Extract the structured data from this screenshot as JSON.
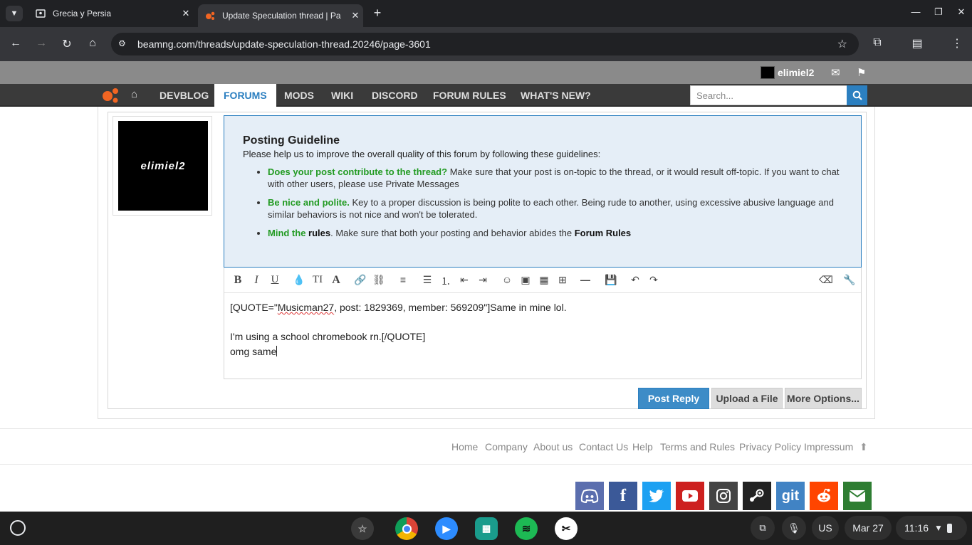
{
  "browser": {
    "tabs": [
      {
        "title": "Grecia y Persia",
        "active": false
      },
      {
        "title": "Update Speculation thread | Pa",
        "active": true
      }
    ],
    "url": "beamng.com/threads/update-speculation-thread.20246/page-3601"
  },
  "user": {
    "name": "elimiel2"
  },
  "nav": {
    "items": [
      "DEVBLOG",
      "FORUMS",
      "MODS",
      "WIKI",
      "DISCORD",
      "FORUM RULES",
      "WHAT'S NEW?"
    ],
    "active": "FORUMS",
    "search_placeholder": "Search..."
  },
  "avatar_text": "elimiel2",
  "guideline": {
    "title": "Posting Guideline",
    "intro": "Please help us to improve the overall quality of this forum by following these guidelines:",
    "item1_lead": "Does your post contribute to the thread?",
    "item1_text": " Make sure that your post is on-topic to the thread, or it would result off-topic. If you want to chat with other users, please use Private Messages",
    "item2_lead": "Be nice and polite.",
    "item2_text": " Key to a proper discussion is being polite to each other. Being rude to another, using excessive abusive language and similar behaviors is not nice and won't be tolerated.",
    "item3_lead": "Mind the",
    "item3_bold": " rules",
    "item3_text": ". Make sure that both your posting and behavior abides the ",
    "item3_link": "Forum Rules"
  },
  "editor": {
    "line1_a": "[QUOTE=\"",
    "line1_b": "Musicman27",
    "line1_c": ", post: 1829369, member: 569209\"]Same in mine lol.",
    "line2": "I'm using a school chromebook rn.[/QUOTE]",
    "line3": "omg same"
  },
  "buttons": {
    "post_reply": "Post Reply",
    "upload": "Upload a File",
    "more": "More Options..."
  },
  "footer": {
    "links": [
      "Home",
      "Company",
      "About us",
      "Contact Us",
      "Help",
      "Terms and Rules",
      "Privacy Policy",
      "Impressum"
    ]
  },
  "social": {
    "git_label": "git",
    "colors": [
      "#5b6eae",
      "#3b5998",
      "#1da1f2",
      "#cd201f",
      "#444444",
      "#222222",
      "#4183c4",
      "#ff4500",
      "#2e7d32"
    ]
  },
  "shelf": {
    "keyboard": "US",
    "date": "Mar 27",
    "time": "11:16"
  }
}
